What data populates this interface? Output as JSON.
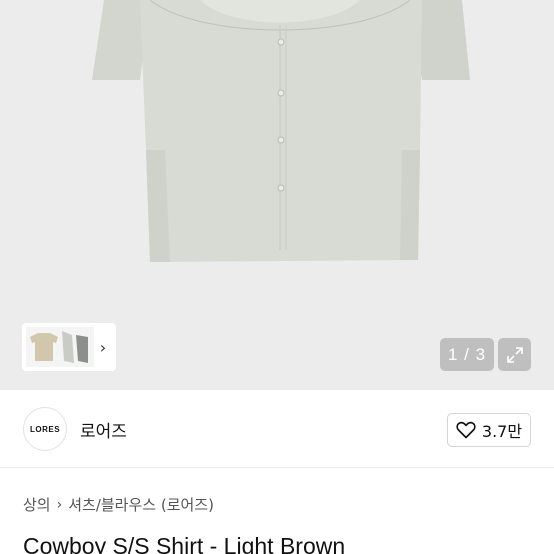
{
  "gallery": {
    "counter": "1 / 3",
    "colors": {
      "background": "#ececec",
      "shirt": "#d6d8d2",
      "badge": "#bfbfbf"
    }
  },
  "shop": {
    "logo_text": "LORES",
    "name": "로어즈",
    "likes": "3.7만"
  },
  "breadcrumb": {
    "level1": "상의",
    "level2": "셔츠/블라우스 (로어즈)"
  },
  "product": {
    "title": "Cowboy S/S Shirt - Light Brown"
  },
  "icons": {
    "thumb_next": "chevron-right-icon",
    "expand": "expand-icon",
    "like": "heart-icon"
  }
}
